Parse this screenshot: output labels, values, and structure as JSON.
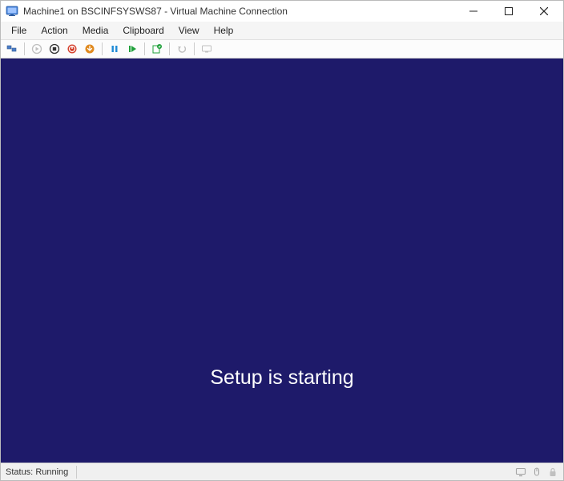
{
  "title": "Machine1 on BSCINFSYSWS87 - Virtual Machine Connection",
  "menu": {
    "file": "File",
    "action": "Action",
    "media": "Media",
    "clipboard": "Clipboard",
    "view": "View",
    "help": "Help"
  },
  "vm": {
    "message": "Setup is starting",
    "bg_color": "#1e1a6a"
  },
  "status": {
    "label": "Status:",
    "value": "Running"
  }
}
